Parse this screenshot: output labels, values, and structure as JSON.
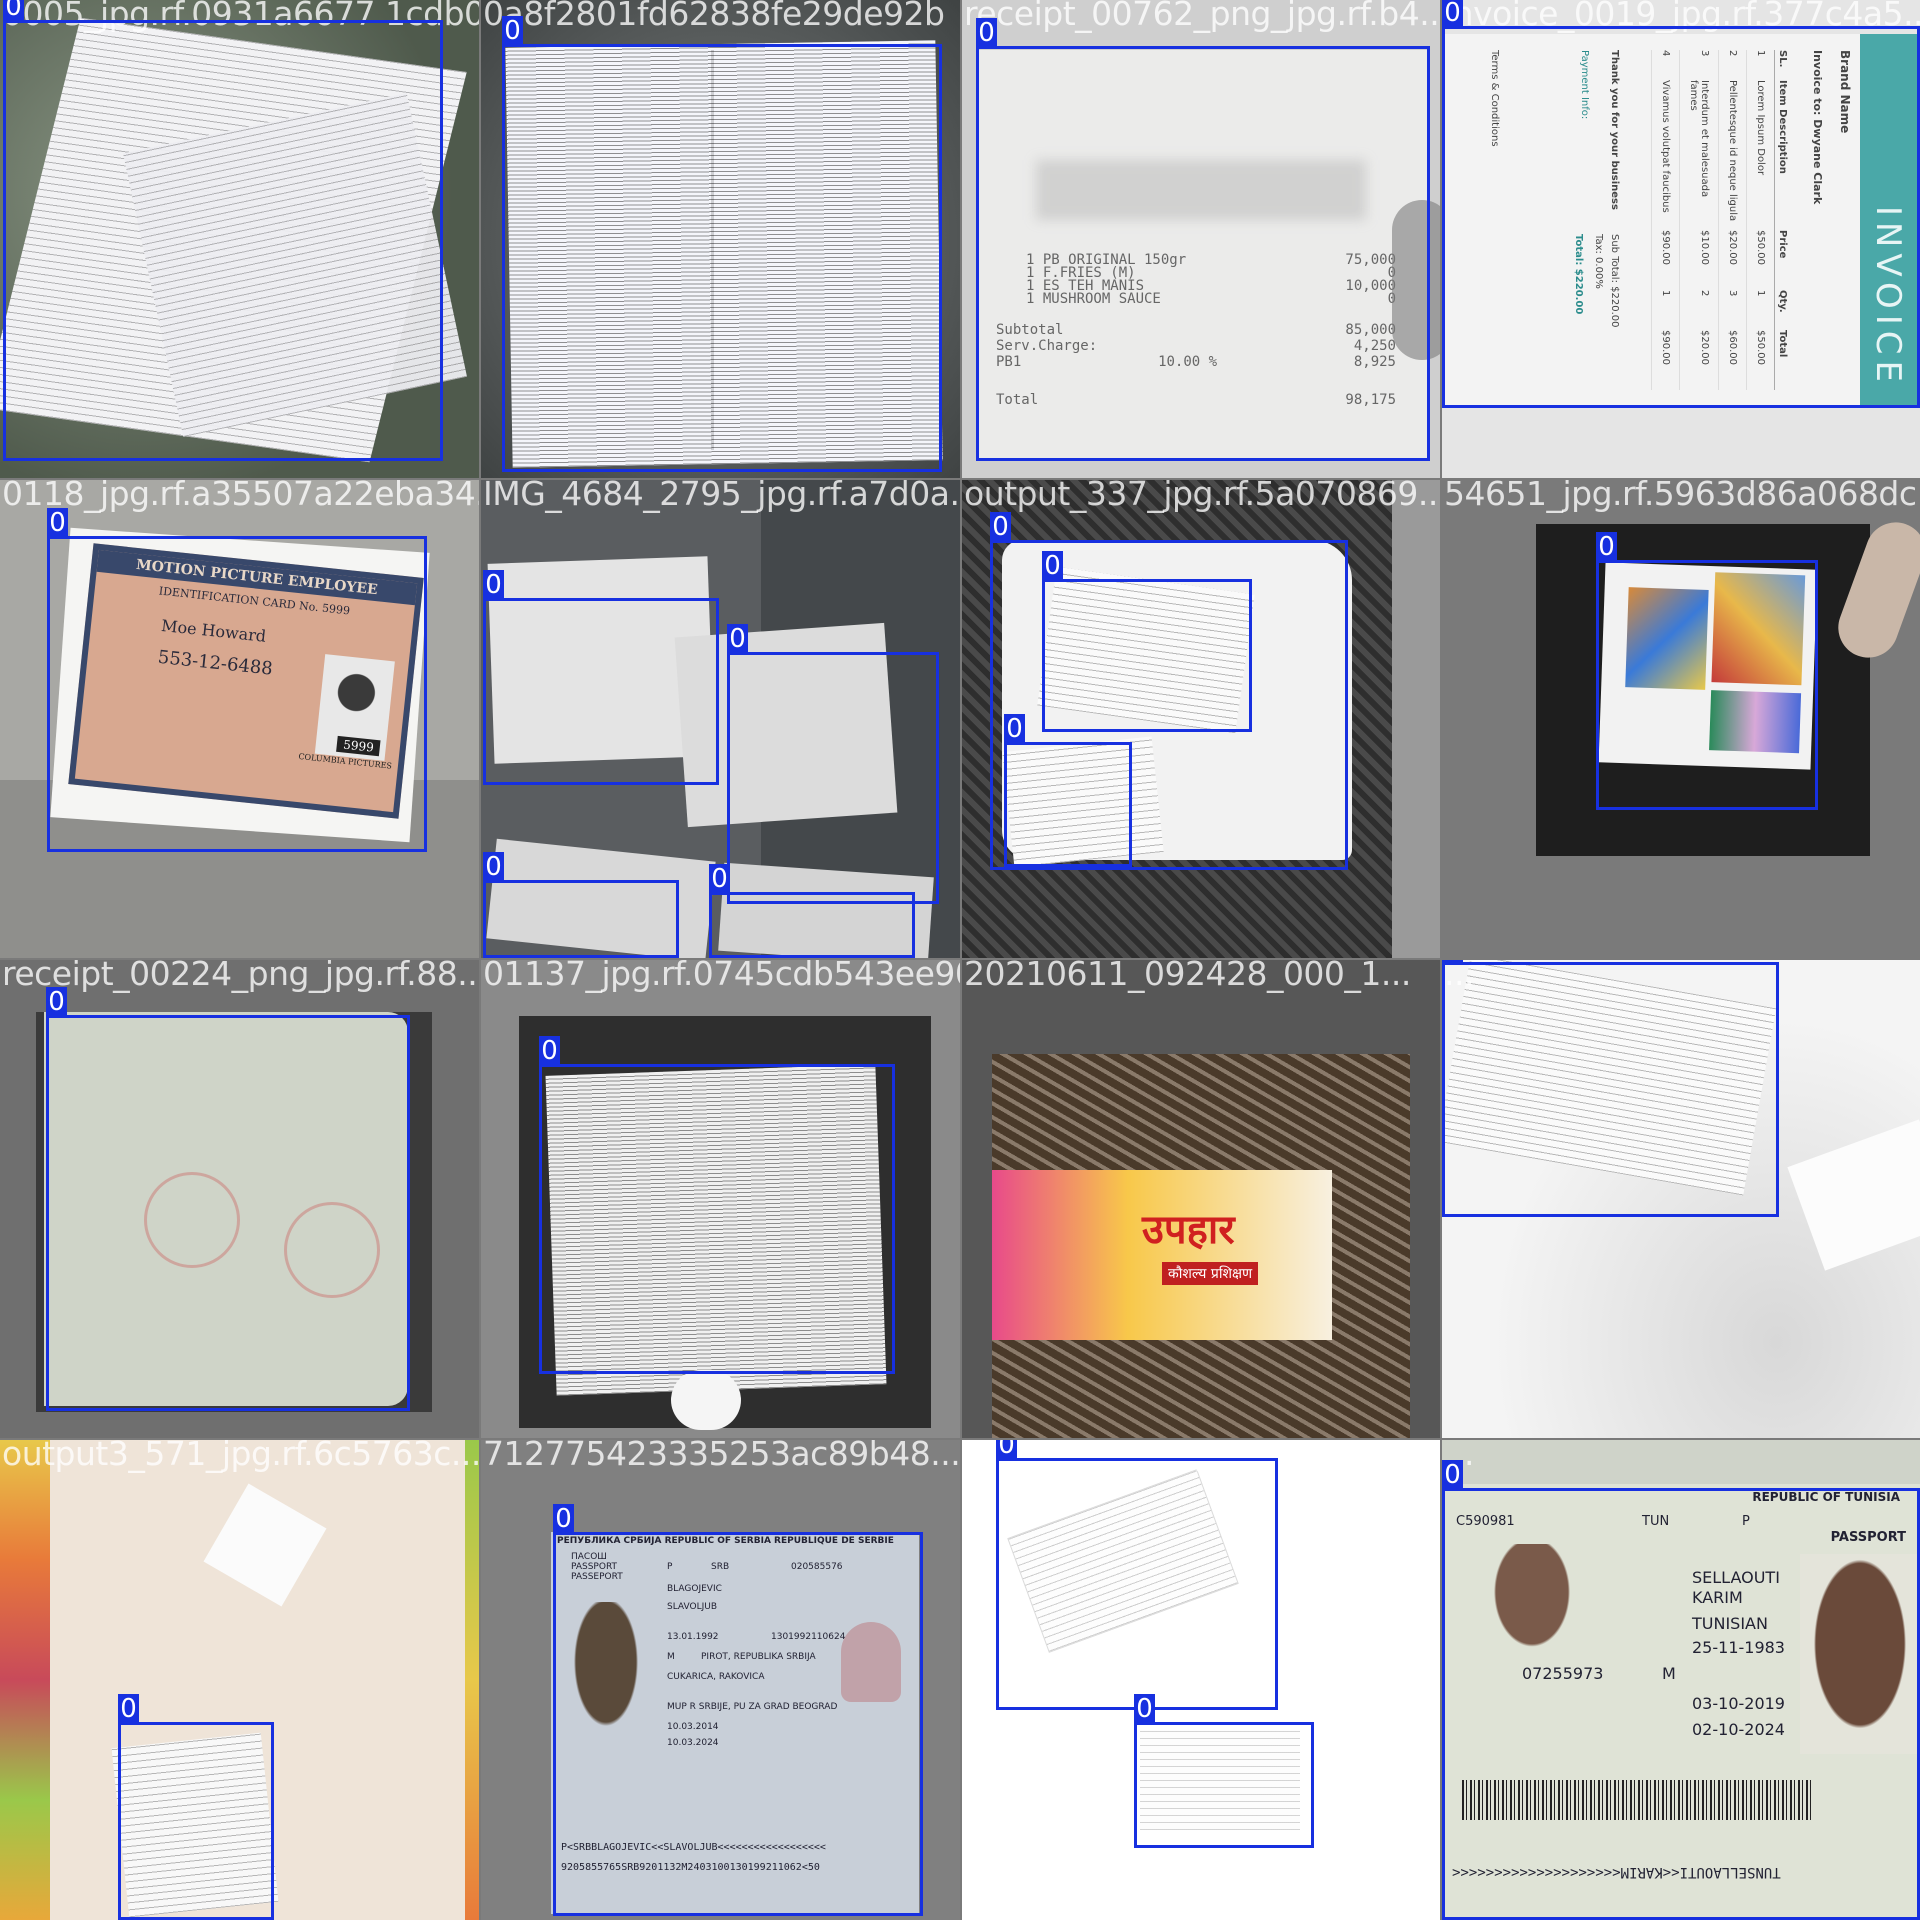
{
  "label_color": "#1730e0",
  "tiles": [
    {
      "filename": "0005_jpg.rf.0931a6677 1cdb0e36828",
      "labels": [
        "0"
      ],
      "bg": "#6f7a6a"
    },
    {
      "filename": "0a8f2801fd62838fe29de92b",
      "labels": [
        "0"
      ],
      "bg": "#5d625f"
    },
    {
      "filename": "receipt_00762_png_jpg.rf.b4...",
      "labels": [
        "0"
      ],
      "bg": "#d8d8d8"
    },
    {
      "filename": "invoice_0019_jpg.rf.377c4a5...",
      "labels": [
        "0"
      ],
      "bg": "#e8e8e8"
    },
    {
      "filename": "0118_jpg.rf.a35507a22eba34...",
      "labels": [
        "0"
      ],
      "bg": "#9b9b97"
    },
    {
      "filename": "IMG_4684_2795_jpg.rf.a7d0a...",
      "labels": [
        "0",
        "0",
        "0",
        "0"
      ],
      "bg": "#575a5c"
    },
    {
      "filename": "output_337_jpg.rf.5a070869...",
      "labels": [
        "0",
        "0",
        "0"
      ],
      "bg": "#3a3a3a"
    },
    {
      "filename": "54651_jpg.rf.5963d86a068dc",
      "labels": [
        "0"
      ],
      "bg": "#777777"
    },
    {
      "filename": "receipt_00224_png_jpg.rf.88...",
      "labels": [
        "0"
      ],
      "bg": "#555555"
    },
    {
      "filename": "01137_jpg.rf.0745cdb543ee90...",
      "labels": [
        "0"
      ],
      "bg": "#8a8a8a"
    },
    {
      "filename": "20210611_092428_000_1...",
      "labels": [],
      "bg": "#5a5a5a"
    },
    {
      "filename": "...",
      "labels": [
        "0"
      ],
      "bg": "#ededed"
    },
    {
      "filename": "output3_571_jpg.rf.6c5763c...",
      "labels": [
        "0"
      ],
      "bg": "#f1e6dc"
    },
    {
      "filename": "712775423335253ac89b48...",
      "labels": [
        "0"
      ],
      "bg": "#7d7d7d"
    },
    {
      "filename": "output_469_jpg.rf.c2145d8...",
      "labels": [
        "0",
        "0"
      ],
      "bg": "#ffffff"
    },
    {
      "filename": "...",
      "labels": [
        "0"
      ],
      "bg": "#cfd3c9"
    }
  ],
  "docs": {
    "receipt": {
      "items": [
        "1 PB ORIGINAL 150gr",
        "1 F.FRIES (M)",
        "1 ES TEH MANIS",
        "1 MUSHROOM SAUCE"
      ],
      "prices": [
        "75,000",
        "0",
        "10,000",
        "0"
      ],
      "subtotal_label": "Subtotal",
      "subtotal": "85,000",
      "service_label": "Serv.Charge:",
      "service": "4,250",
      "tax_label": "PB1",
      "tax_pct": "10.00 %",
      "tax": "8,925",
      "total_label": "Total",
      "total": "98,175"
    },
    "invoice": {
      "brand": "Brand Name",
      "title": "INVOICE",
      "to": "Invoice to: Dwyane Clark",
      "headers": [
        "SL.",
        "Item Description",
        "Price",
        "Qty.",
        "Total"
      ],
      "rows": [
        [
          "1",
          "Lorem Ipsum Dolor",
          "$50.00",
          "1",
          "$50.00"
        ],
        [
          "2",
          "Pellentesque id neque ligula",
          "$20.00",
          "3",
          "$60.00"
        ],
        [
          "3",
          "Interdum et malesuada fames",
          "$10.00",
          "2",
          "$20.00"
        ],
        [
          "4",
          "Vivamus volutpat faucibus",
          "$90.00",
          "1",
          "$90.00"
        ]
      ],
      "thanks": "Thank you for your business",
      "sub_total": "Sub Total: $220.00",
      "tax": "Tax: 0.00%",
      "total": "Total: $220.00",
      "payment": "Payment Info:",
      "terms": "Terms & Conditions"
    },
    "id_card": {
      "line1": "MOTION PICTURE EMPLOYEE",
      "line2": "IDENTIFICATION CARD No. 5999",
      "name": "Moe Howard",
      "ssn": "553-12-6488",
      "badge": "5999",
      "studio": "COLUMBIA PICTURES"
    },
    "poster": {
      "headline": "उपहार",
      "subline": "कौशल्य प्रशिक्षण"
    },
    "passport_rs": {
      "header": "РЕПУБЛИКА СРБИЈА   REPUBLIC OF SERBIA   REPUBLIQUE DE SERBIE",
      "type": "ПАСОШ PASSPORT PASSEPORT",
      "code": "P",
      "country": "SRB",
      "number": "020585576",
      "surname": "BLAGOJEVIC",
      "given": "SLAVOLJUB",
      "dob": "13.01.1992",
      "sex": "M",
      "birthplace": "PIROT, REPUBLIKA SRBIJA",
      "district": "CUKARICA, RAKOVICA",
      "doc_num": "1301992110624",
      "issued_by": "MUP R SRBIJE, PU ZA GRAD BEOGRAD",
      "issued": "10.03.2014",
      "expiry": "10.03.2024",
      "mrz1": "P<SRBBLAGOJEVIC<<SLAVOLJUB<<<<<<<<<<<<<<<<<<",
      "mrz2": "9205855765SRB9201132M2403100130199211062<50"
    },
    "passport_tn": {
      "header": "REPUBLIC OF TUNISIA",
      "type": "PASSPORT",
      "code": "P",
      "country": "TUN",
      "number": "C590981",
      "surname": "SELLAOUTI",
      "given": "KARIM",
      "nationality": "TUNISIAN",
      "dob": "25-11-1983",
      "sex": "M",
      "id_no": "07255973",
      "issued": "03-10-2019",
      "expiry": "02-10-2024",
      "mrz": "TUNSELLAOUTI<<KARIM<<<<<<<<<<<<<<<<<<<<"
    }
  }
}
